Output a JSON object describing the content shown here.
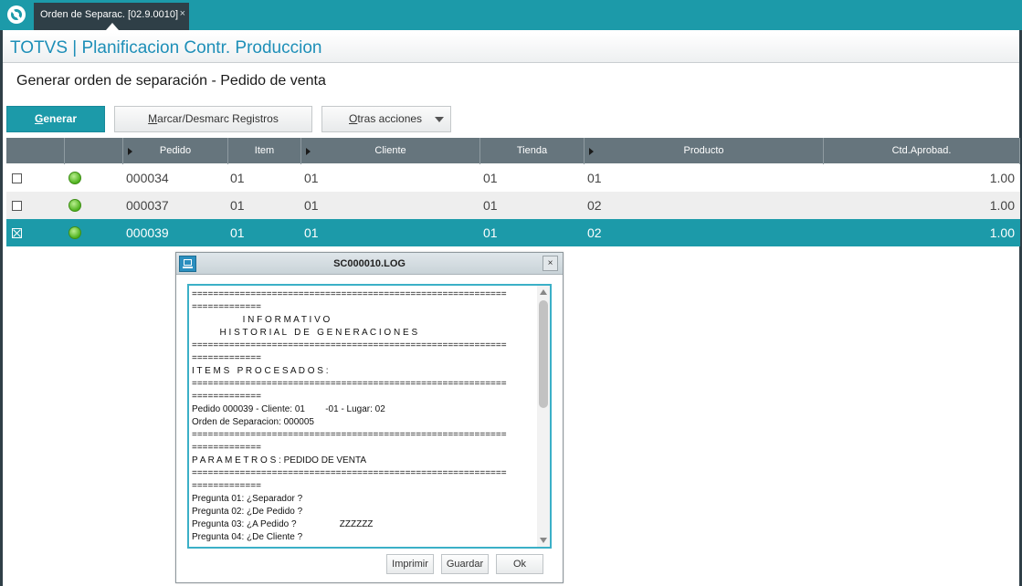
{
  "tab": {
    "label": "Orden de Separac. [02.9.0010]",
    "close": "×"
  },
  "module": {
    "title": "TOTVS | Planificacion Contr. Produccion"
  },
  "page": {
    "title": "Generar orden de separación - Pedido de venta"
  },
  "toolbar": {
    "generar_first": "G",
    "generar_rest": "enerar",
    "marcar_first": "M",
    "marcar_rest": "arcar/Desmarc Registros",
    "otras_first": "O",
    "otras_rest": "tras acciones"
  },
  "grid": {
    "headers": {
      "pedido": "Pedido",
      "item": "Item",
      "cliente": "Cliente",
      "tienda": "Tienda",
      "producto": "Producto",
      "ctd": "Ctd.Aprobad."
    },
    "rows": [
      {
        "checked": false,
        "pedido": "000034",
        "item": "01",
        "cliente": "01",
        "tienda": "01",
        "producto": "01",
        "ctd": "1.00"
      },
      {
        "checked": false,
        "pedido": "000037",
        "item": "01",
        "cliente": "01",
        "tienda": "01",
        "producto": "02",
        "ctd": "1.00"
      },
      {
        "checked": true,
        "pedido": "000039",
        "item": "01",
        "cliente": "01",
        "tienda": "01",
        "producto": "02",
        "ctd": "1.00"
      }
    ]
  },
  "dialog": {
    "title": "SC000010.LOG",
    "close": "×",
    "log_lines": [
      "===========================================================",
      "=============",
      "                    I N F O R M A T I V O",
      "           H I S T O R I A L   D E   G E N E R A C I O N E S",
      "===========================================================",
      "=============",
      "I T E M S   P R O C E S A D O S :",
      "===========================================================",
      "=============",
      "Pedido 000039 - Cliente: 01        -01 - Lugar: 02",
      "Orden de Separacion: 000005",
      "===========================================================",
      "=============",
      "P A R A M E T R O S : PEDIDO DE VENTA",
      "===========================================================",
      "=============",
      "Pregunta 01: ¿Separador ?",
      "Pregunta 02: ¿De Pedido ?",
      "Pregunta 03: ¿A Pedido ?                 ZZZZZZ",
      "Pregunta 04: ¿De Cliente ?"
    ],
    "buttons": {
      "imprimir": "Imprimir",
      "guardar": "Guardar",
      "ok": "Ok"
    }
  }
}
